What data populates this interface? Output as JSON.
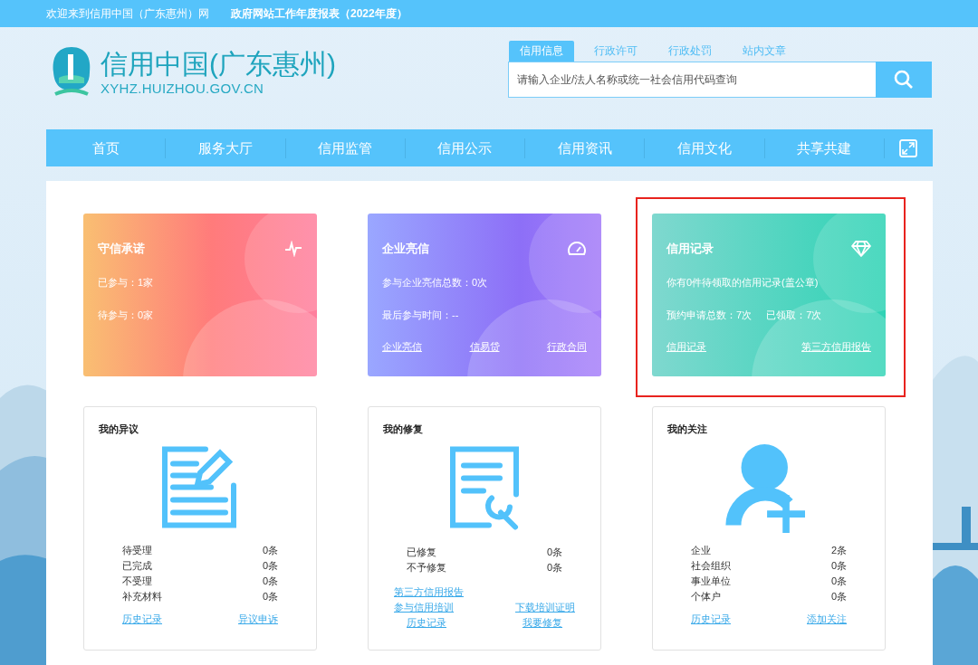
{
  "top_bar": {
    "welcome": "欢迎来到信用中国（广东惠州）网",
    "report_link": "政府网站工作年度报表（2022年度）"
  },
  "logo": {
    "title": "信用中国(广东惠州)",
    "domain": "XYHZ.HUIZHOU.GOV.CN"
  },
  "search": {
    "tabs": [
      {
        "label": "信用信息",
        "selected": true
      },
      {
        "label": "行政许可",
        "selected": false
      },
      {
        "label": "行政处罚",
        "selected": false
      },
      {
        "label": "站内文章",
        "selected": false
      }
    ],
    "placeholder": "请输入企业/法人名称或统一社会信用代码查询"
  },
  "nav": {
    "items": [
      "首页",
      "服务大厅",
      "信用监管",
      "信用公示",
      "信用资讯",
      "信用文化",
      "共享共建"
    ]
  },
  "feature_cards": [
    {
      "kind": "promise",
      "title": "守信承诺",
      "highlighted": false,
      "lines": [
        [
          "已参与：1家"
        ],
        [
          "待参与：0家"
        ]
      ]
    },
    {
      "kind": "rating",
      "title": "企业亮信",
      "highlighted": false,
      "lines": [
        [
          "参与企业亮信总数：0次"
        ],
        [
          "最后参与时间：--"
        ]
      ],
      "links": [
        "企业亮信",
        "信易贷",
        "行政合同"
      ]
    },
    {
      "kind": "record",
      "title": "信用记录",
      "highlighted": true,
      "lines": [
        [
          "你有0件待领取的信用记录(盖公章)"
        ],
        [
          "预约申请总数：7次",
          "已领取：7次"
        ]
      ],
      "links": [
        "信用记录",
        "第三方信用报告"
      ]
    }
  ],
  "panels": [
    {
      "kind": "objection",
      "title": "我的异议",
      "stats": [
        {
          "label": "待受理",
          "value": "0条"
        },
        {
          "label": "已完成",
          "value": "0条"
        },
        {
          "label": "不受理",
          "value": "0条"
        },
        {
          "label": "补充材料",
          "value": "0条"
        }
      ],
      "link_rows": [
        [
          "历史记录",
          "异议申诉"
        ]
      ]
    },
    {
      "kind": "repair",
      "title": "我的修复",
      "stats": [
        {
          "label": "已修复",
          "value": "0条"
        },
        {
          "label": "不予修复",
          "value": "0条"
        }
      ],
      "link_rows": [
        [
          "第三方信用报告"
        ],
        [
          "参与信用培训",
          "下载培训证明"
        ],
        [
          "历史记录",
          "我要修复"
        ]
      ]
    },
    {
      "kind": "follow",
      "title": "我的关注",
      "stats": [
        {
          "label": "企业",
          "value": "2条"
        },
        {
          "label": "社会组织",
          "value": "0条"
        },
        {
          "label": "事业单位",
          "value": "0条"
        },
        {
          "label": "个体户",
          "value": "0条"
        }
      ],
      "link_rows": [
        [
          "历史记录",
          "添加关注"
        ]
      ]
    }
  ]
}
